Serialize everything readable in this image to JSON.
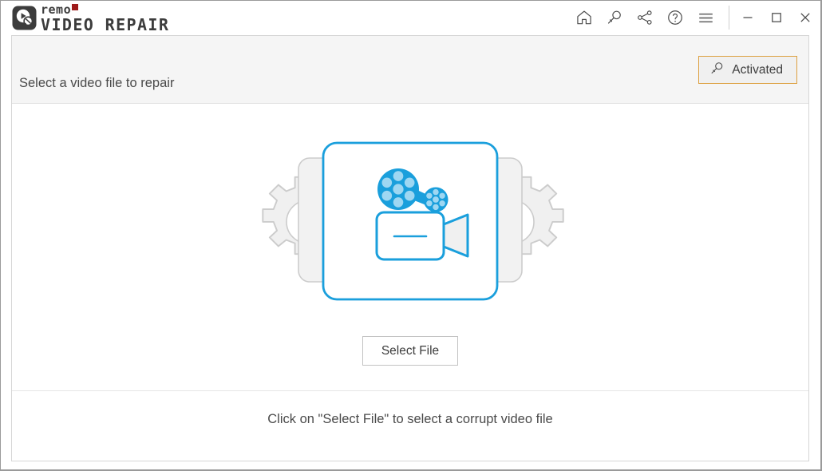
{
  "window": {
    "app_name": "Remo Video Repair",
    "brand_line1": "remo",
    "brand_line2": "VIDEO REPAIR",
    "brand_accent_color": "#9e1b1b"
  },
  "titlebar": {
    "icons": [
      {
        "name": "home-icon",
        "tooltip": "Home"
      },
      {
        "name": "key-icon",
        "tooltip": "Activate"
      },
      {
        "name": "share-icon",
        "tooltip": "Share"
      },
      {
        "name": "help-icon",
        "tooltip": "Help"
      },
      {
        "name": "menu-icon",
        "tooltip": "Menu"
      }
    ],
    "controls": [
      {
        "name": "minimize-button",
        "glyph": "minimize"
      },
      {
        "name": "maximize-button",
        "glyph": "maximize"
      },
      {
        "name": "close-button",
        "glyph": "close"
      }
    ]
  },
  "header": {
    "title": "Select a video file to repair",
    "activated_label": "Activated",
    "activated_border_color": "#dda040",
    "activated_icon": "key-icon",
    "band_color": "#f5f5f5"
  },
  "main": {
    "illustration": {
      "name": "video-repair-illustration",
      "accent_color": "#1a9fdc",
      "gear_fill": "#f0f0f0",
      "gear_stroke": "#cccccc",
      "panel_fill": "#f2f2f2",
      "panel_stroke": "#cccccc",
      "parts": [
        "left-gear",
        "right-gear",
        "left-panel",
        "right-panel",
        "center-card",
        "film-reel-large",
        "film-reel-small",
        "video-camera"
      ]
    },
    "select_file_label": "Select File"
  },
  "footer": {
    "hint": "Click on \"Select File\" to select a corrupt video file"
  }
}
